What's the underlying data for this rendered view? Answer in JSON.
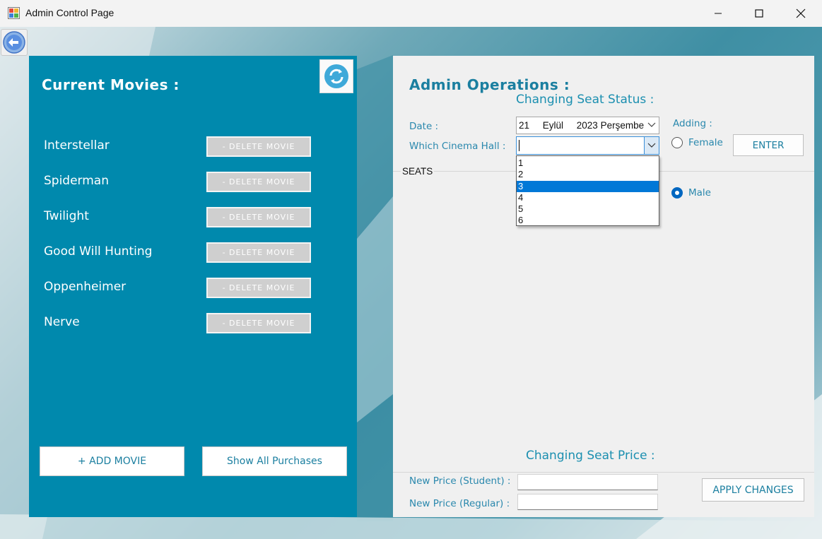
{
  "window": {
    "title": "Admin Control Page"
  },
  "movies_panel": {
    "heading": "Current Movies :",
    "movies": [
      {
        "name": "Interstellar",
        "delete_label": "- DELETE MOVIE"
      },
      {
        "name": "Spiderman",
        "delete_label": "- DELETE MOVIE"
      },
      {
        "name": "Twilight",
        "delete_label": "- DELETE MOVIE"
      },
      {
        "name": "Good Will Hunting",
        "delete_label": "- DELETE MOVIE"
      },
      {
        "name": "Oppenheimer",
        "delete_label": "- DELETE MOVIE"
      },
      {
        "name": "Nerve",
        "delete_label": "- DELETE MOVIE"
      }
    ],
    "add_movie_label": "+ ADD MOVIE",
    "show_purchases_label": "Show All Purchases"
  },
  "admin_panel": {
    "heading": "Admin Operations :",
    "seat_status": {
      "title": "Changing Seat Status :",
      "date_label": "Date :",
      "date_value": "21     Eylül     2023 Perşembe",
      "hall_label": "Which Cinema Hall :",
      "hall_value": "",
      "hall_options": [
        "1",
        "2",
        "3",
        "4",
        "5",
        "6"
      ],
      "hall_selected_index": 2,
      "adding_label": "Adding :",
      "female_label": "Female",
      "male_label": "Male",
      "selected_gender": "Male",
      "enter_label": "ENTER",
      "seats_label": "SEATS"
    },
    "seat_price": {
      "title": "Changing Seat Price :",
      "student_label": "New Price (Student) :",
      "regular_label": "New Price (Regular) :",
      "student_value": "",
      "regular_value": "",
      "apply_label": "APPLY CHANGES"
    }
  },
  "colors": {
    "panel_teal": "#0089ad",
    "accent_text": "#1b7fa0",
    "selection": "#0078d7"
  }
}
